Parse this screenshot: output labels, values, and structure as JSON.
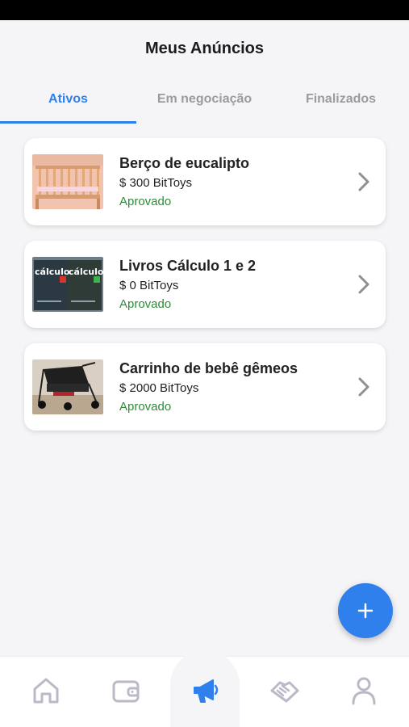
{
  "header": {
    "title": "Meus Anúncios"
  },
  "tabs": [
    {
      "label": "Ativos",
      "active": true
    },
    {
      "label": "Em negociação",
      "active": false
    },
    {
      "label": "Finalizados",
      "active": false
    }
  ],
  "listings": [
    {
      "title": "Berço de eucalipto",
      "price": "$ 300 BitToys",
      "status": "Aprovado",
      "image": "crib-photo"
    },
    {
      "title": "Livros Cálculo 1 e 2",
      "price": "$ 0 BitToys",
      "status": "Aprovado",
      "image": "calculus-books-photo",
      "image_text": [
        "cálculo",
        "cálculo"
      ]
    },
    {
      "title": "Carrinho de bebê gêmeos",
      "price": "$ 2000 BitToys",
      "status": "Aprovado",
      "image": "twin-stroller-photo"
    }
  ],
  "fab": {
    "icon": "plus-icon"
  },
  "bottom_nav": [
    {
      "icon": "home-icon"
    },
    {
      "icon": "wallet-icon"
    },
    {
      "icon": "megaphone-icon",
      "active": true
    },
    {
      "icon": "handshake-icon"
    },
    {
      "icon": "user-icon"
    }
  ],
  "colors": {
    "accent": "#2f80ed",
    "approved": "#2e8b3a",
    "inactive": "#b9b9c8"
  }
}
